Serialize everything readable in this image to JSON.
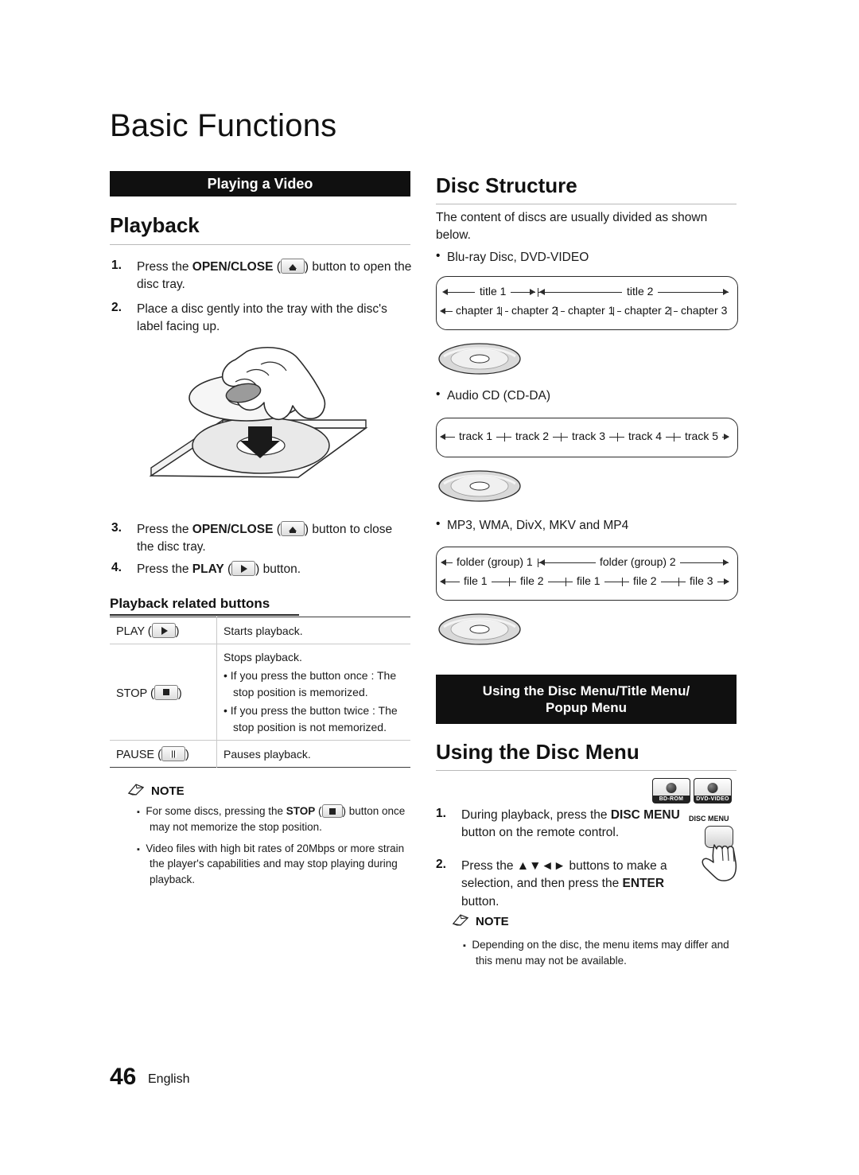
{
  "page": {
    "title": "Basic Functions",
    "folio_number": "46",
    "folio_language": "English"
  },
  "left_column": {
    "banner": "Playing a Video",
    "playback_heading": "Playback",
    "steps": [
      {
        "num": "1.",
        "text_before": "Press the ",
        "bold": "OPEN/CLOSE",
        "text_after": " (",
        "text_end": ") button to open the disc tray."
      },
      {
        "num": "2.",
        "text_before": "Place a disc gently into the tray with the disc's label facing up."
      },
      {
        "num": "3.",
        "text_before": "Press the ",
        "bold": "OPEN/CLOSE",
        "text_after": " (",
        "text_end": ") button to close the disc tray."
      },
      {
        "num": "4.",
        "text_before": "Press the ",
        "bold": "PLAY",
        "text_after": " (",
        "text_end": ") button."
      }
    ],
    "related_buttons_heading": "Playback related buttons",
    "table": {
      "rows": [
        {
          "label": "PLAY (",
          "label_end": ")",
          "icon": "play-icon",
          "lines": [
            "Starts playback."
          ]
        },
        {
          "label": "STOP (",
          "label_end": ")",
          "icon": "stop-icon",
          "lines": [
            "Stops playback.",
            "• If you press the button once : The",
            "stop position is memorized.",
            "• If you press the button twice : The",
            "stop position is not memorized."
          ]
        },
        {
          "label": "PAUSE (",
          "label_end": ")",
          "icon": "pause-icon",
          "lines": [
            "Pauses playback."
          ]
        }
      ]
    },
    "note": {
      "title": "NOTE",
      "items": [
        "For some discs, pressing the STOP ( ) button once may not memorize the stop position.",
        "Video files with high bit rates of 20Mbps or more strain the player's capabilities and may stop playing during playback."
      ],
      "item1_pre": "For some discs, pressing the ",
      "item1_bold": "STOP",
      "item1_mid": " (",
      "item1_post": ") button once may not memorize the stop position.",
      "item2": "Video files with high bit rates of 20Mbps or more strain the player's capabilities and may stop playing during playback."
    }
  },
  "right_column": {
    "disc_structure_heading": "Disc Structure",
    "disc_structure_intro": "The content of discs are usually divided as shown below.",
    "bullets": {
      "bluray": "Blu-ray Disc, DVD-VIDEO",
      "audiocd": "Audio CD (CD-DA)",
      "mp3": "MP3, WMA, DivX, MKV and MP4"
    },
    "diagram_bluray": {
      "titles": [
        "title 1",
        "title 2"
      ],
      "chapters": [
        "chapter 1",
        "chapter 2",
        "chapter 1",
        "chapter 2",
        "chapter 3"
      ]
    },
    "diagram_audiocd": {
      "tracks": [
        "track 1",
        "track 2",
        "track 3",
        "track 4",
        "track 5"
      ]
    },
    "diagram_mp3": {
      "folders": [
        "folder (group) 1",
        "folder (group) 2"
      ],
      "files": [
        "file 1",
        "file 2",
        "file 1",
        "file 2",
        "file 3"
      ]
    },
    "menu_banner_line1": "Using the Disc Menu/Title Menu/",
    "menu_banner_line2": "Popup Menu",
    "using_disc_menu_heading": "Using the Disc Menu",
    "badges": [
      {
        "name": "bd-rom-badge",
        "caption": "BD-ROM"
      },
      {
        "name": "dvd-video-badge",
        "caption": "DVD-VIDEO"
      }
    ],
    "disc_menu_button_caption": "DISC MENU",
    "steps": [
      {
        "num": "1.",
        "pre": "During playback, press the ",
        "bold1": "DISC MENU",
        "post": " button on the remote control."
      },
      {
        "num": "2.",
        "pre": "Press the ",
        "arrows": "▲▼◄►",
        "mid": " buttons to make a selection, and then press the ",
        "bold2": "ENTER",
        "post": " button."
      }
    ],
    "note": {
      "title": "NOTE",
      "item": "Depending on the disc, the menu items may differ and this menu may not be available."
    }
  }
}
